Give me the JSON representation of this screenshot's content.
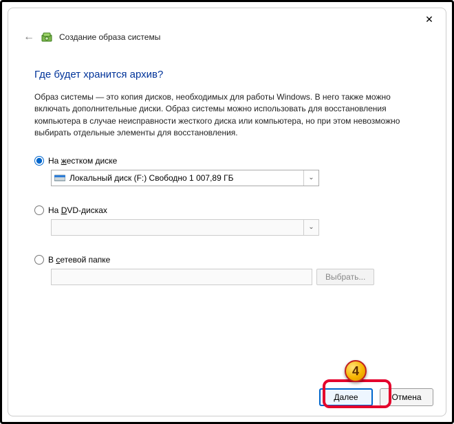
{
  "window": {
    "title": "Создание образа системы",
    "close_glyph": "✕"
  },
  "page": {
    "heading": "Где будет хранится архив?",
    "description": "Образ системы — это копия дисков, необходимых для работы Windows. В него также можно включать дополнительные диски. Образ системы можно использовать для восстановления компьютера в случае неисправности жесткого диска или компьютера, но при этом невозможно выбирать отдельные элементы для восстановления."
  },
  "options": {
    "hard_drive": {
      "label_pre": "На ",
      "label_u": "ж",
      "label_post": "естком диске",
      "selected": "Локальный диск (F:)  Свободно 1 007,89 ГБ"
    },
    "dvd": {
      "label_pre": "На ",
      "label_u": "D",
      "label_post": "VD-дисках"
    },
    "network": {
      "label_pre": "В ",
      "label_u": "с",
      "label_post": "етевой папке",
      "browse": "Выбрать..."
    }
  },
  "buttons": {
    "next_pre": "",
    "next_u": "Д",
    "next_post": "алее",
    "cancel": "Отмена"
  },
  "annotation": {
    "number": "4"
  }
}
